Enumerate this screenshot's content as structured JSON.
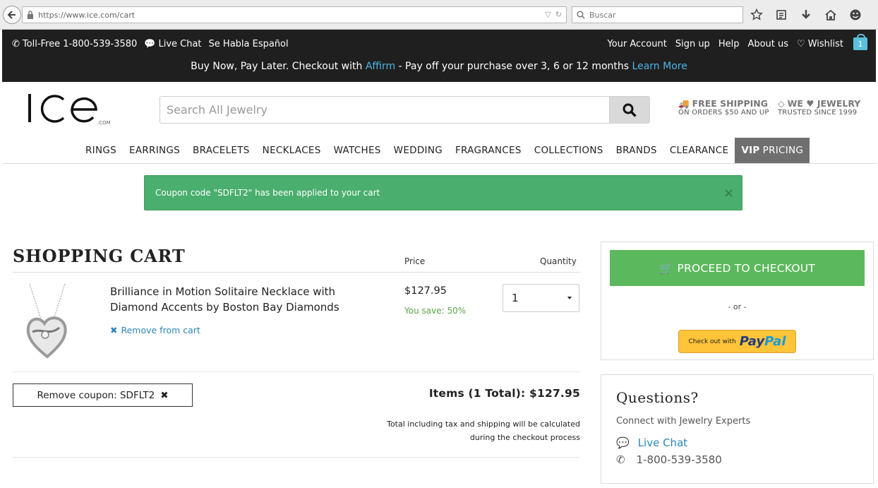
{
  "browser": {
    "url": "https://www.ice.com/cart",
    "search_placeholder": "Buscar"
  },
  "topbar": {
    "phone": "Toll-Free 1-800-539-3580",
    "live_chat": "Live Chat",
    "spanish": "Se Habla Español",
    "account": "Your Account",
    "signup": "Sign up",
    "help": "Help",
    "about": "About us",
    "wishlist": "Wishlist",
    "cart_count": "1",
    "promo_prefix": "Buy Now, Pay Later. Checkout with ",
    "promo_affirm": "Affirm",
    "promo_middle": " - Pay off your purchase over 3, 6 or 12 months ",
    "promo_learn": "Learn More"
  },
  "header": {
    "logo_text": "ICE",
    "logo_suffix": ".COM",
    "search_placeholder": "Search All Jewelry",
    "badge1_title": "FREE SHIPPING",
    "badge1_sub": "ON ORDERS $50 AND UP",
    "badge2_title": "WE ♥ JEWELRY",
    "badge2_sub": "TRUSTED SINCE 1999"
  },
  "nav": {
    "items": [
      "RINGS",
      "EARRINGS",
      "BRACELETS",
      "NECKLACES",
      "WATCHES",
      "WEDDING",
      "FRAGRANCES",
      "COLLECTIONS",
      "BRANDS",
      "CLEARANCE"
    ],
    "vip_bold": "VIP",
    "vip_rest": "PRICING"
  },
  "alert": {
    "message": "Coupon code \"SDFLT2\" has been applied to your cart",
    "close": "×"
  },
  "cart": {
    "title": "SHOPPING CART",
    "price_header": "Price",
    "qty_header": "Quantity",
    "product_name": "Brilliance in Motion Solitaire Necklace with Diamond Accents by Boston Bay Diamonds",
    "remove": "Remove from cart",
    "price": "$127.95",
    "savings": "You save: 50%",
    "quantity": "1",
    "coupon_button": "Remove coupon: SDFLT2",
    "items_total": "Items (1 Total): $127.95",
    "note_line1": "Total including tax and shipping will be calculated",
    "note_line2": "during the checkout process"
  },
  "checkout": {
    "button": "PROCEED TO CHECKOUT",
    "or": "- or -",
    "paypal_small": "Check out with",
    "paypal_pay": "Pay",
    "paypal_pal": "Pal"
  },
  "questions": {
    "title": "Questions?",
    "subtitle": "Connect with Jewelry Experts",
    "chat": "Live Chat",
    "phone": "1-800-539-3580"
  },
  "colors": {
    "topbar": "#1f1f1f",
    "link_blue": "#4db3e6",
    "alert_green": "#4aae6e",
    "checkout_green": "#5cb85c",
    "vip_gray": "#6f6f6f",
    "save_green": "#5aa64a",
    "paypal_yellow": "#ffc439"
  }
}
